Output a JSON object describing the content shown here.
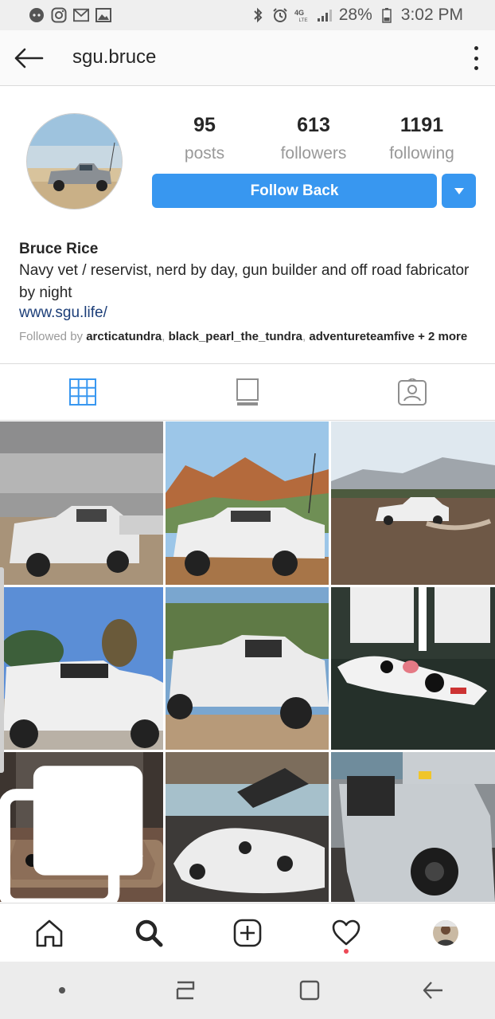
{
  "status_bar": {
    "time": "3:02 PM",
    "battery": "28%",
    "network": "4G LTE",
    "left_icons": [
      "discord-icon",
      "instagram-icon",
      "gmail-icon",
      "gallery-icon"
    ],
    "right_icons": [
      "bluetooth-icon",
      "alarm-icon",
      "lte-icon",
      "signal-icon",
      "battery-icon"
    ]
  },
  "header": {
    "username": "sgu.bruce"
  },
  "profile": {
    "stats": [
      {
        "value": "95",
        "label": "posts"
      },
      {
        "value": "613",
        "label": "followers"
      },
      {
        "value": "1191",
        "label": "following"
      }
    ],
    "follow_button": "Follow Back",
    "name": "Bruce Rice",
    "bio": "Navy vet / reservist, nerd by day, gun builder and off road fabricator by night",
    "website": "www.sgu.life/",
    "followed_by_prefix": "Followed by ",
    "followed_by_users": [
      "arcticatundra",
      "black_pearl_the_tundra",
      "adventureteamfive"
    ],
    "followed_by_more": "+ 2 more"
  },
  "tabs": [
    {
      "name": "grid",
      "active": true
    },
    {
      "name": "feed",
      "active": false
    },
    {
      "name": "tagged",
      "active": false
    }
  ],
  "bottom_nav": [
    "home",
    "search",
    "add",
    "activity",
    "profile"
  ],
  "colors": {
    "accent": "#3897f0",
    "link": "#1c3e78",
    "notification": "#ed4956",
    "muted": "#999999"
  }
}
